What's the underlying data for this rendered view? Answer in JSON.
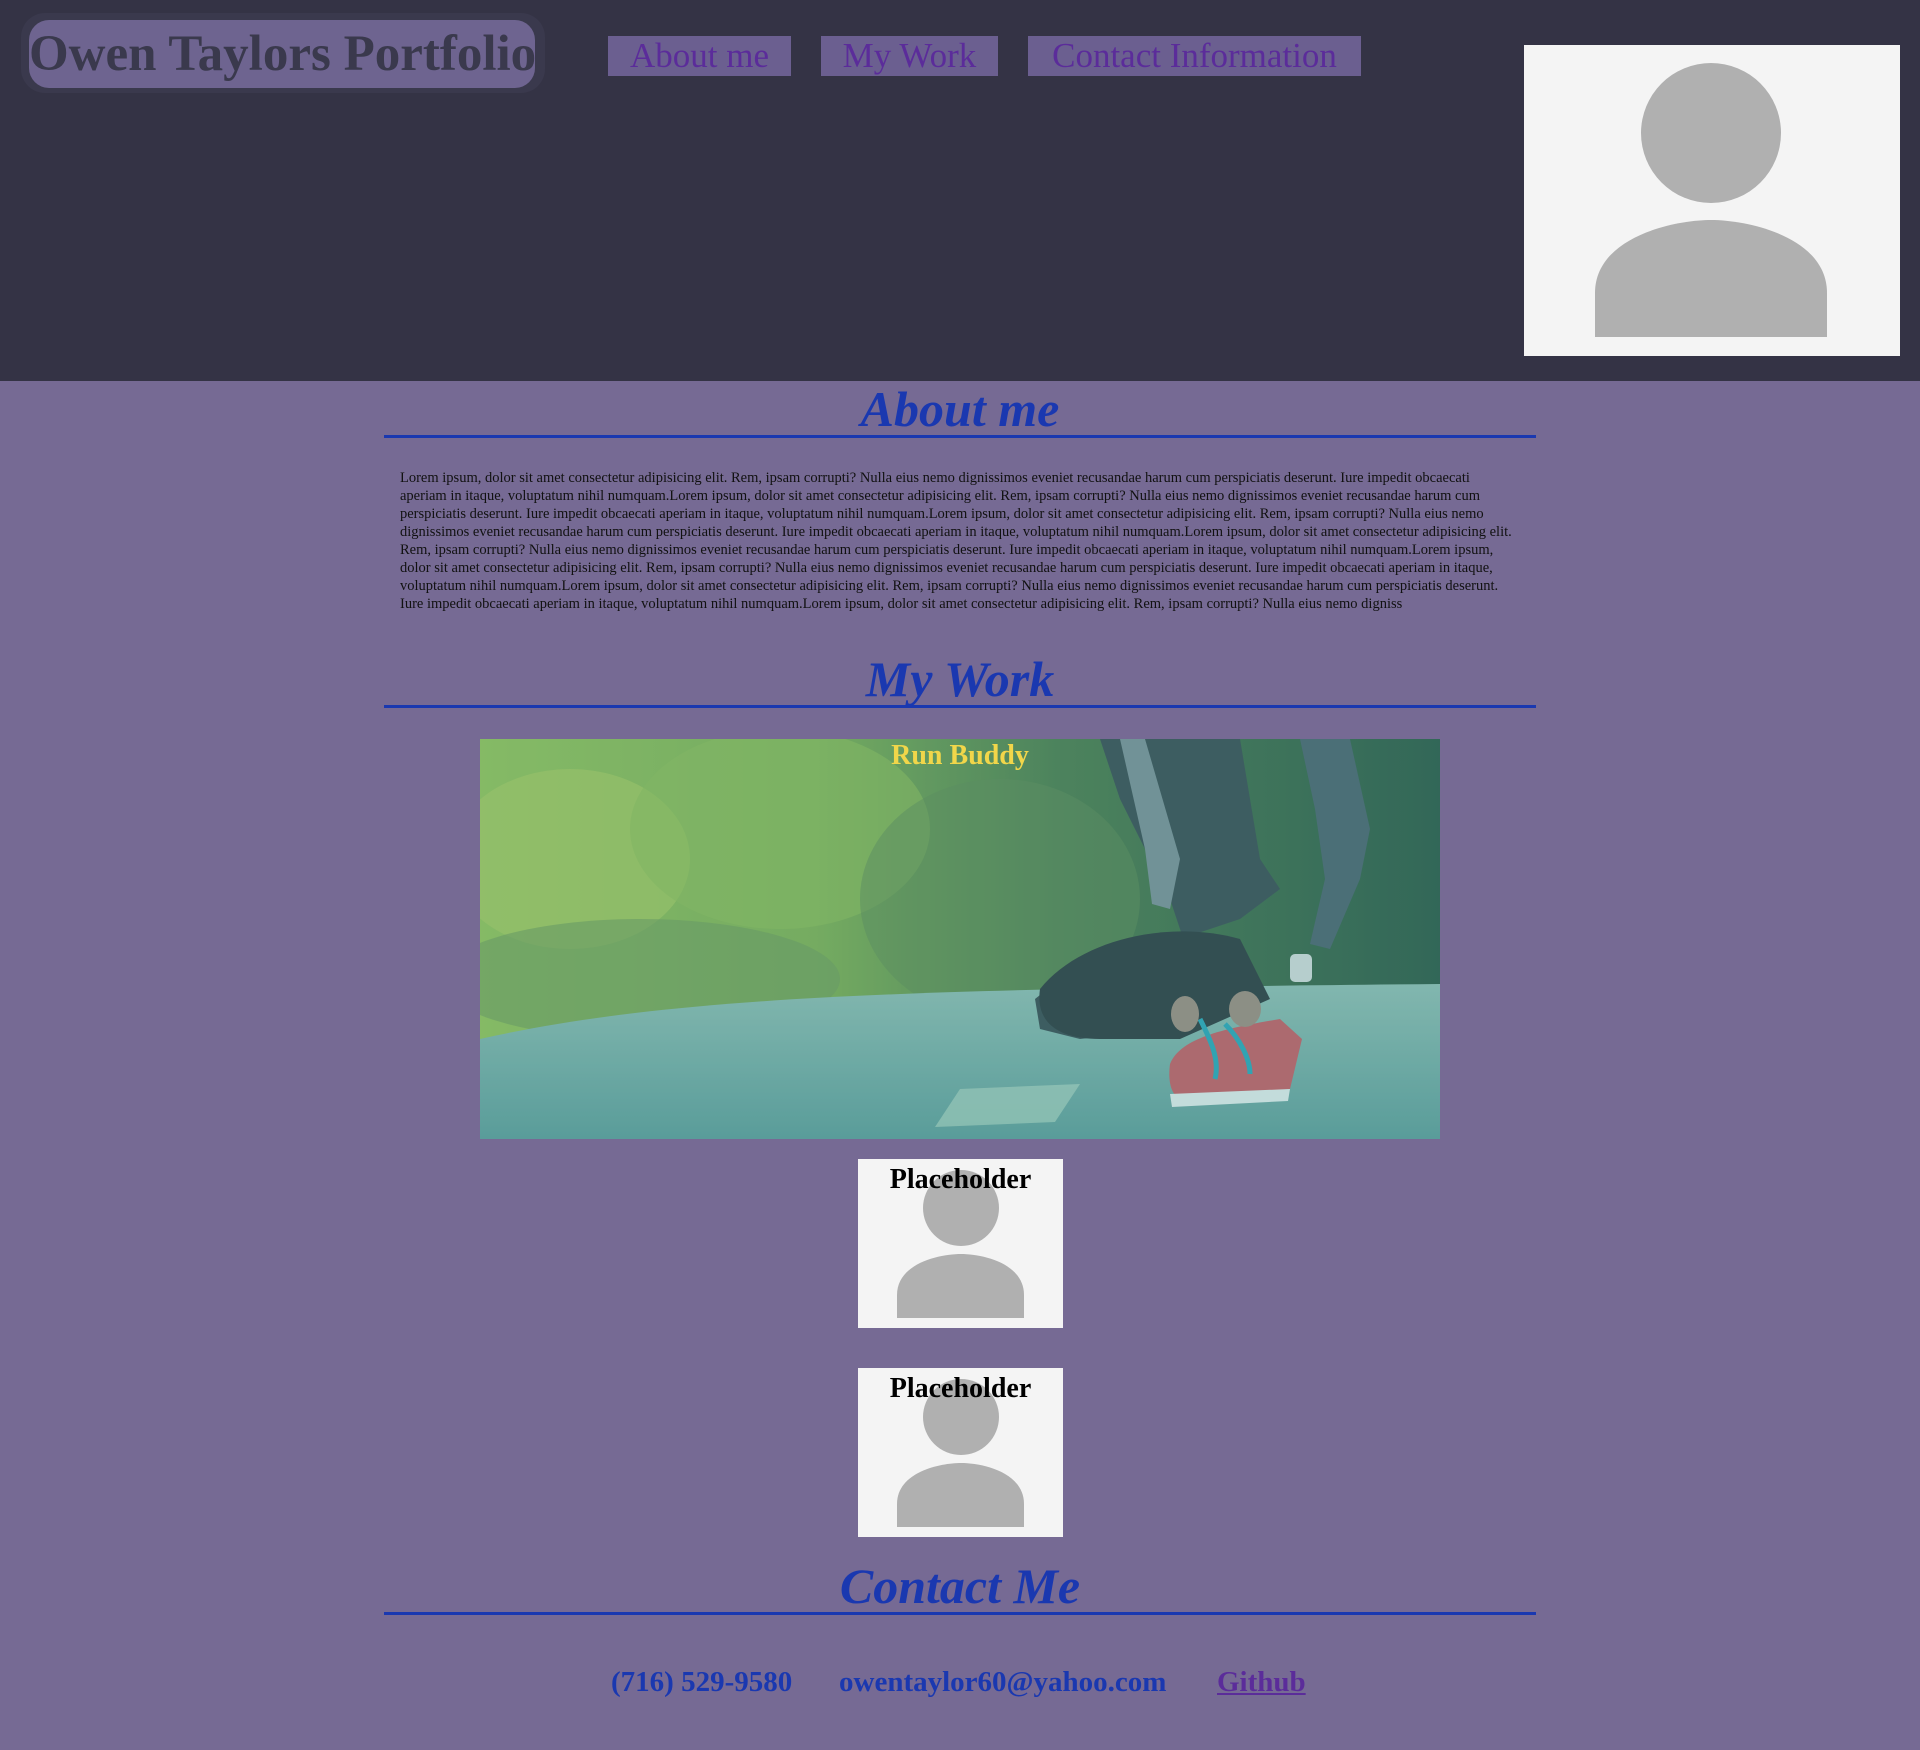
{
  "header": {
    "brand": "Owen Taylors Portfolio",
    "nav": [
      {
        "label": "About me"
      },
      {
        "label": "My Work"
      },
      {
        "label": "Contact Information"
      }
    ],
    "profile_photo_icon": "person-silhouette-icon"
  },
  "about": {
    "title": "About me",
    "text": "Lorem ipsum, dolor sit amet consectetur adipisicing elit. Rem, ipsam corrupti? Nulla eius nemo dignissimos eveniet recusandae harum cum perspiciatis deserunt. Iure impedit obcaecati aperiam in itaque, voluptatum nihil numquam.Lorem ipsum, dolor sit amet consectetur adipisicing elit. Rem, ipsam corrupti? Nulla eius nemo dignissimos eveniet recusandae harum cum perspiciatis deserunt. Iure impedit obcaecati aperiam in itaque, voluptatum nihil numquam.Lorem ipsum, dolor sit amet consectetur adipisicing elit. Rem, ipsam corrupti? Nulla eius nemo dignissimos eveniet recusandae harum cum perspiciatis deserunt. Iure impedit obcaecati aperiam in itaque, voluptatum nihil numquam.Lorem ipsum, dolor sit amet consectetur adipisicing elit. Rem, ipsam corrupti? Nulla eius nemo dignissimos eveniet recusandae harum cum perspiciatis deserunt. Iure impedit obcaecati aperiam in itaque, voluptatum nihil numquam.Lorem ipsum, dolor sit amet consectetur adipisicing elit. Rem, ipsam corrupti? Nulla eius nemo dignissimos eveniet recusandae harum cum perspiciatis deserunt. Iure impedit obcaecati aperiam in itaque, voluptatum nihil numquam.Lorem ipsum, dolor sit amet consectetur adipisicing elit. Rem, ipsam corrupti? Nulla eius nemo dignissimos eveniet recusandae harum cum perspiciatis deserunt. Iure impedit obcaecati aperiam in itaque, voluptatum nihil numquam.Lorem ipsum, dolor sit amet consectetur adipisicing elit. Rem, ipsam corrupti? Nulla eius nemo digniss"
  },
  "work": {
    "title": "My Work",
    "projects": [
      {
        "title": "Run Buddy"
      },
      {
        "title": "Placeholder"
      },
      {
        "title": "Placeholder"
      }
    ]
  },
  "contact": {
    "title": "Contact Me",
    "phone": "(716) 529-9580",
    "email": "owentaylor60@yahoo.com",
    "github": "Github"
  },
  "colors": {
    "header_bg": "#343345",
    "page_bg": "#766a94",
    "accent_blue": "#1a38b0",
    "nav_text": "#5b2c9a",
    "project_title_yellow": "#f1d64a"
  }
}
